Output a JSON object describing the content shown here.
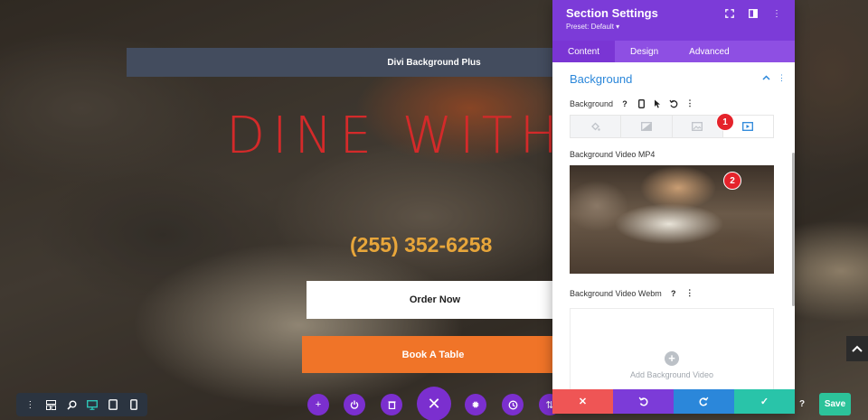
{
  "page": {
    "top_bar_title": "Divi Background Plus",
    "hero_title": "DINE WITH",
    "phone": "(255) 352-6258",
    "order_button": "Order Now",
    "book_button": "Book A Table"
  },
  "panel": {
    "title": "Section Settings",
    "preset": "Preset: Default ▾",
    "tabs": [
      "Content",
      "Design",
      "Advanced"
    ],
    "active_tab": "Content",
    "group_title": "Background",
    "background_label": "Background",
    "video_mp4_label": "Background Video MP4",
    "video_webm_label": "Background Video Webm",
    "add_video_text": "Add Background Video",
    "badge_1": "1",
    "badge_2": "2"
  },
  "toolbar": {
    "save_label": "Save",
    "help": "?"
  },
  "colors": {
    "accent": "#7c3bd8",
    "blue": "#2b87da",
    "cancel": "#ef5555",
    "confirm": "#29c4a9",
    "hero_title": "#d42a2a",
    "phone": "#e8a63a",
    "book_button": "#f07428",
    "badge": "#e5232b"
  },
  "icons": {
    "view_bar": [
      "dots-vertical-icon",
      "wireframe-icon",
      "zoom-icon",
      "desktop-icon",
      "tablet-icon",
      "phone-icon"
    ],
    "center_buttons": [
      "add-icon",
      "power-icon",
      "trash-icon",
      "close-icon",
      "gear-icon",
      "history-icon",
      "sort-icon"
    ],
    "background_types": [
      "color-fill-icon",
      "gradient-icon",
      "image-icon",
      "video-icon"
    ]
  }
}
